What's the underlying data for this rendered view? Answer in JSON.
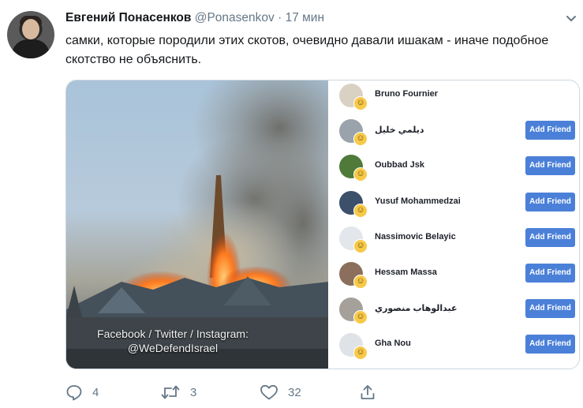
{
  "tweet": {
    "author_name": "Евгений Понасенков",
    "author_handle": "@Ponasenkov",
    "separator": "·",
    "time": "17 мин",
    "text": "самки, которые породили этих скотов, очевидно давали ишакам - иначе подобное скотство не объяснить."
  },
  "media": {
    "caption_line1": "Facebook / Twitter / Instagram:",
    "caption_line2": "@WeDefendIsrael",
    "friends": [
      {
        "name": "Bruno Fournier",
        "button": ""
      },
      {
        "name": "ديلمي خليل",
        "button": "Add Friend"
      },
      {
        "name": "Oubbad Jsk",
        "button": "Add Friend"
      },
      {
        "name": "Yusuf Mohammedzai",
        "button": "Add Friend"
      },
      {
        "name": "Nassimovic Belayic",
        "button": "Add Friend"
      },
      {
        "name": "Hessam Massa",
        "button": "Add Friend"
      },
      {
        "name": "عبدالوهاب منصوري",
        "button": "Add Friend"
      },
      {
        "name": "Gha Nou",
        "button": "Add Friend"
      }
    ],
    "reaction_emoji": "haha-emoji"
  },
  "actions": {
    "reply_count": "4",
    "retweet_count": "3",
    "like_count": "32",
    "share_icon": "share-icon"
  },
  "colors": {
    "secondary_text": "#657786",
    "button_blue": "#4b80d8",
    "border": "#ccd6dd"
  }
}
